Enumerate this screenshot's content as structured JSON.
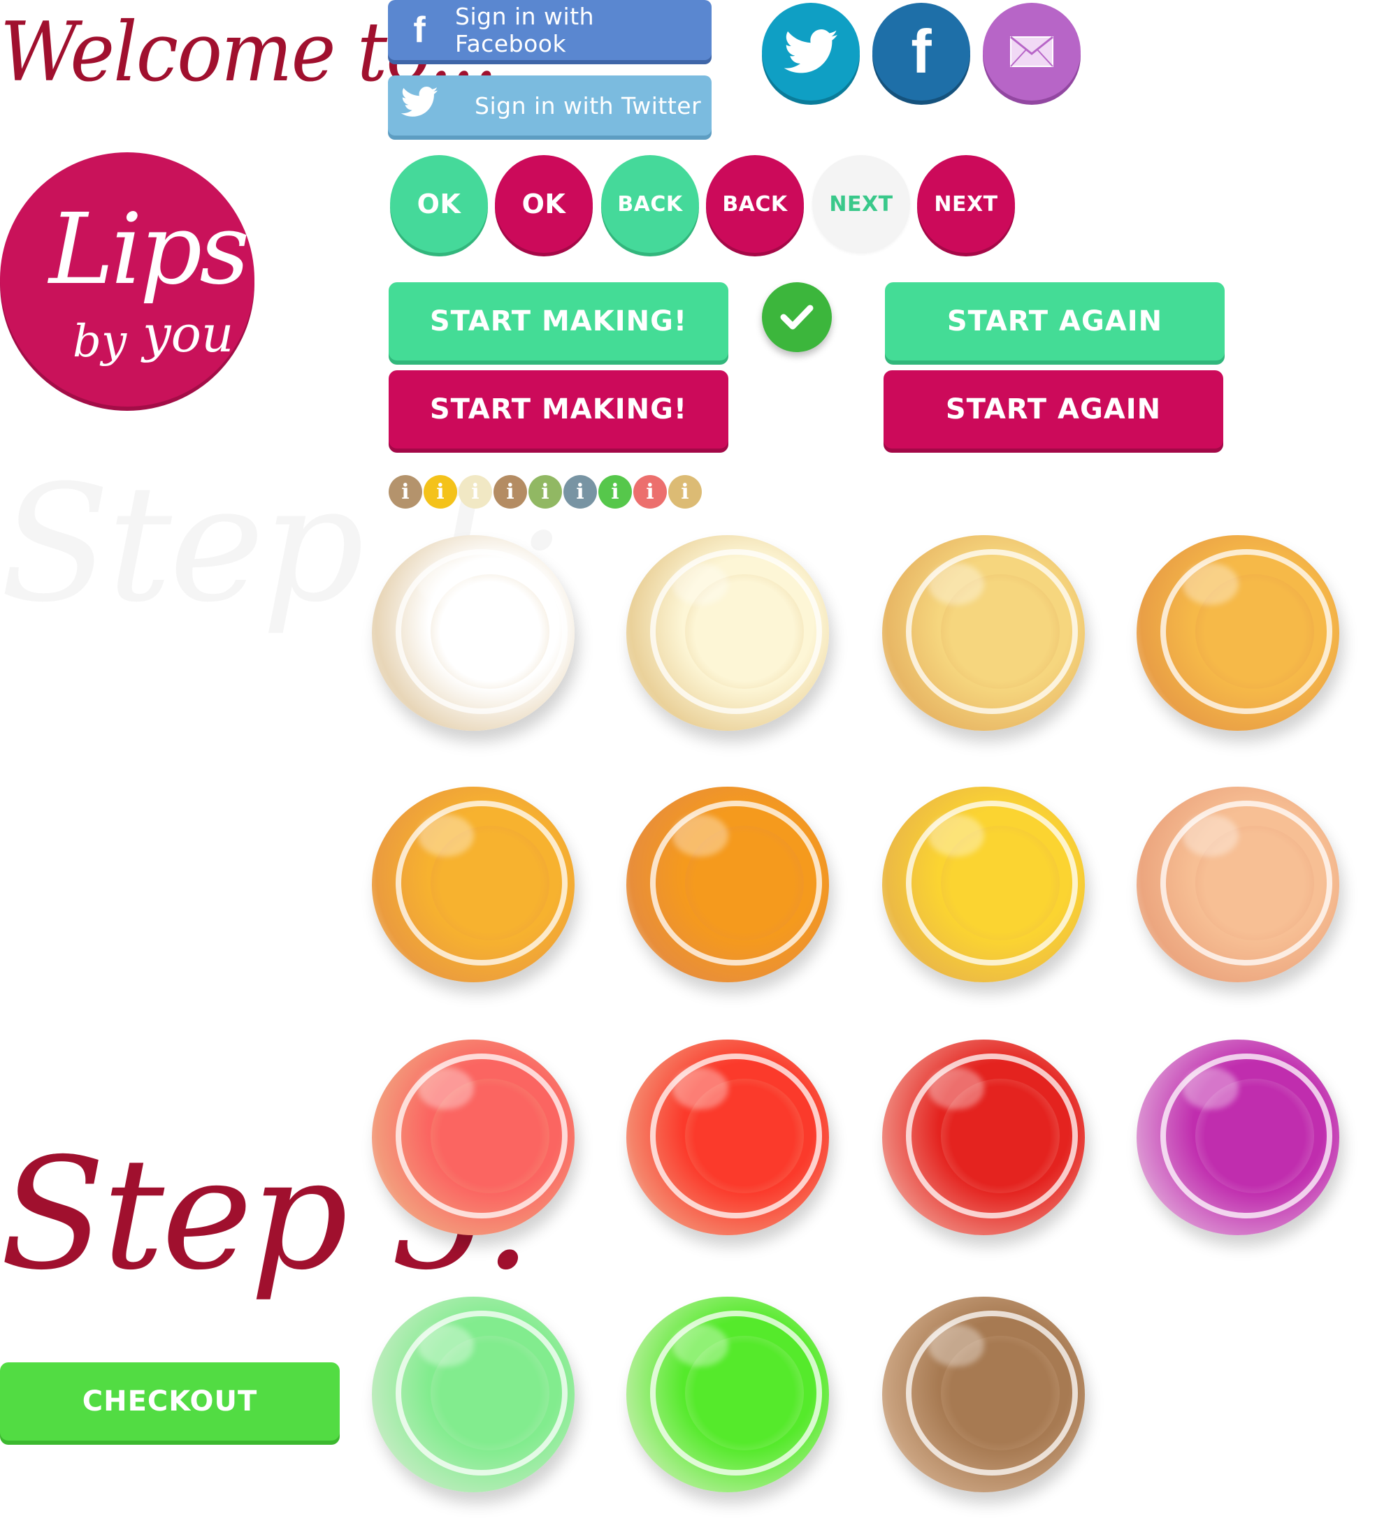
{
  "headings": {
    "welcome": "Welcome to...",
    "step1": "Step 1:",
    "step5": "Step 5:"
  },
  "logo": {
    "line1": "Lips",
    "line2": "by",
    "line3": "you"
  },
  "signin": {
    "facebook_label": "Sign in with Facebook",
    "facebook_icon": "facebook-f-icon",
    "twitter_label": "Sign in with Twitter",
    "twitter_icon": "twitter-bird-icon"
  },
  "social": {
    "twitter_icon": "twitter-bird-icon",
    "facebook_glyph": "f",
    "email_icon": "envelope-icon"
  },
  "nav_buttons": {
    "ok": "OK",
    "back": "BACK",
    "next": "NEXT"
  },
  "big_buttons": {
    "start_making": "START MAKING!",
    "start_again": "START AGAIN",
    "checkout": "CHECKOUT"
  },
  "info_dots": {
    "glyph": "i",
    "colors": [
      "#b4936c",
      "#f4c21a",
      "#f1e8c4",
      "#b48c63",
      "#91b863",
      "#7894a3",
      "#56c74b",
      "#ec6f6d",
      "#dcbb74"
    ]
  },
  "colors": {
    "brand_pink": "#cc0a5a",
    "brand_green": "#44dc96",
    "heading_red": "#a0102e",
    "checkout_green": "#52dc43"
  },
  "pots": [
    {
      "name": "white",
      "color": "#ffffff",
      "edge": "#e8d6b8"
    },
    {
      "name": "cream",
      "color": "#fdf6d6",
      "edge": "#ead19a"
    },
    {
      "name": "pale-yellow",
      "color": "#f6d67e",
      "edge": "#e8b765"
    },
    {
      "name": "amber",
      "color": "#f6b948",
      "edge": "#e99f46"
    },
    {
      "name": "orange-yellow",
      "color": "#f7b22f",
      "edge": "#eb9c3e"
    },
    {
      "name": "orange",
      "color": "#f59a1d",
      "edge": "#e88e3a"
    },
    {
      "name": "yellow",
      "color": "#fbd431",
      "edge": "#ecba45"
    },
    {
      "name": "peach",
      "color": "#f7bf94",
      "edge": "#eca67f"
    },
    {
      "name": "coral",
      "color": "#fb6561",
      "edge": "#f39a7b"
    },
    {
      "name": "red-orange",
      "color": "#fb3a2b",
      "edge": "#f5846a"
    },
    {
      "name": "red",
      "color": "#e4231f",
      "edge": "#ee7e74"
    },
    {
      "name": "purple",
      "color": "#c02dae",
      "edge": "#d98acf"
    },
    {
      "name": "light-green",
      "color": "#82ec8e",
      "edge": "#b8ecb9"
    },
    {
      "name": "green",
      "color": "#55ea2b",
      "edge": "#a9ee8c"
    },
    {
      "name": "brown",
      "color": "#a77a52",
      "edge": "#c9a27f"
    }
  ]
}
